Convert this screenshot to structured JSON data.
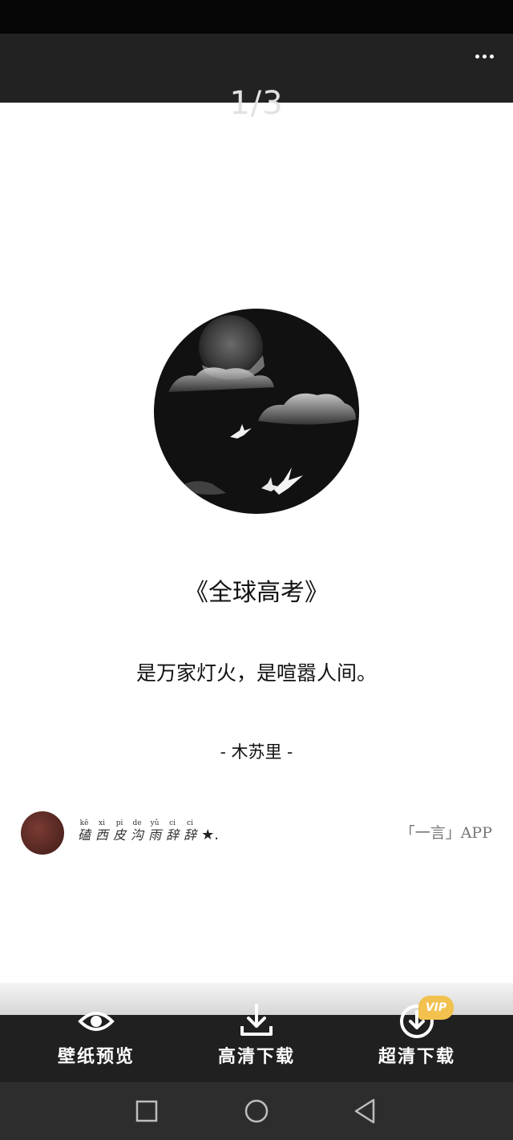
{
  "header": {
    "page_indicator": "1/3",
    "more_icon": "more-horizontal-icon"
  },
  "card": {
    "title": "《全球高考》",
    "quote": "是万家灯火，是喧嚣人间。",
    "author": "- 木苏里 -",
    "artwork": "moon-clouds-cranes-illustration",
    "user": {
      "name_chars": [
        {
          "pinyin": "kē",
          "char": "磕"
        },
        {
          "pinyin": "xi",
          "char": "西"
        },
        {
          "pinyin": "pi",
          "char": "皮"
        },
        {
          "pinyin": "de",
          "char": "沟"
        },
        {
          "pinyin": "yǔ",
          "char": "雨"
        },
        {
          "pinyin": "ci",
          "char": "辞"
        },
        {
          "pinyin": "ci",
          "char": "辞"
        }
      ],
      "name_suffix": "★."
    },
    "brand": "「一言」APP"
  },
  "toolbar": {
    "items": [
      {
        "label": "壁纸预览",
        "icon": "eye-icon"
      },
      {
        "label": "高清下载",
        "icon": "download-icon"
      },
      {
        "label": "超清下载",
        "icon": "download-circle-icon"
      }
    ],
    "vip_badge": "VIP"
  },
  "nav": {
    "recents_icon": "square-icon",
    "home_icon": "circle-icon",
    "back_icon": "triangle-back-icon"
  },
  "colors": {
    "top_bar": "#222222",
    "toolbar": "#202020",
    "nav_bar": "#2d2d2d",
    "vip": "#f2c14e"
  }
}
